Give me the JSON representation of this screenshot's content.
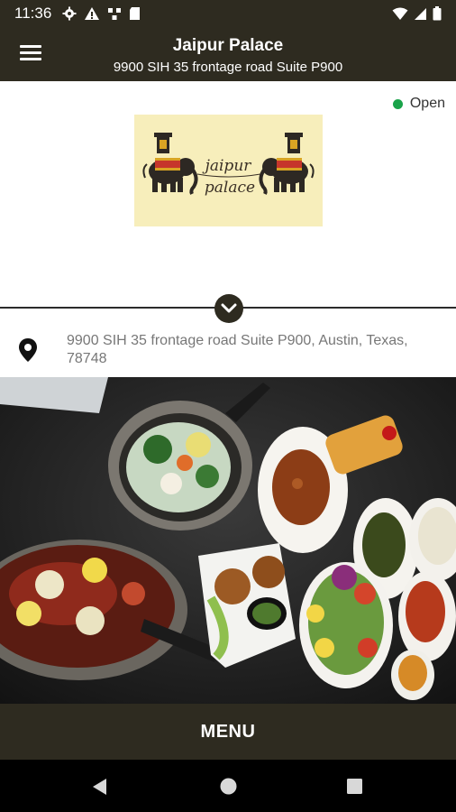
{
  "status_bar": {
    "time": "11:36"
  },
  "app_bar": {
    "title": "Jaipur Palace",
    "subtitle": "9900 SIH 35 frontage road Suite P900"
  },
  "restaurant": {
    "status": "Open",
    "status_color": "#1aa34a",
    "logo_text_line1": "jaipur",
    "logo_text_line2": "palace",
    "address": "9900 SIH 35 frontage road Suite P900, Austin, Texas, 78748"
  },
  "menu_button": {
    "label": "MENU"
  },
  "colors": {
    "bar": "#2e2b20",
    "logo_bg": "#f7eebb"
  },
  "icons": [
    "menu-icon",
    "settings-icon",
    "warning-icon",
    "wifi-icon",
    "signal-icon",
    "battery-icon",
    "chevron-down-icon",
    "location-pin-icon",
    "back-icon",
    "home-icon",
    "recents-icon"
  ]
}
